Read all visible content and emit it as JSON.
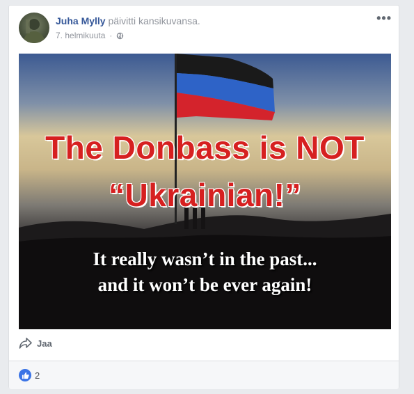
{
  "post": {
    "author_name": "Juha Mylly",
    "action_text": "päivitti kansikuvansa.",
    "date": "7. helmikuuta",
    "privacy_icon": "globe-icon",
    "more_label": "•••"
  },
  "photo": {
    "headline_line1": "The Donbass is NOT",
    "headline_line2": "“Ukrainian!”",
    "subline1": "It really wasn’t in the past...",
    "subline2": "and it won’t be ever again!",
    "flag_colors": [
      "#1a1a1a",
      "#2e63c7",
      "#d4232c"
    ]
  },
  "actions": {
    "share_label": "Jaa",
    "share_icon": "share-arrow-icon"
  },
  "reactions": {
    "like_icon": "thumbs-up-icon",
    "like_count": "2"
  },
  "colors": {
    "link": "#365899",
    "muted": "#90949c",
    "like_blue": "#3b74e6"
  }
}
